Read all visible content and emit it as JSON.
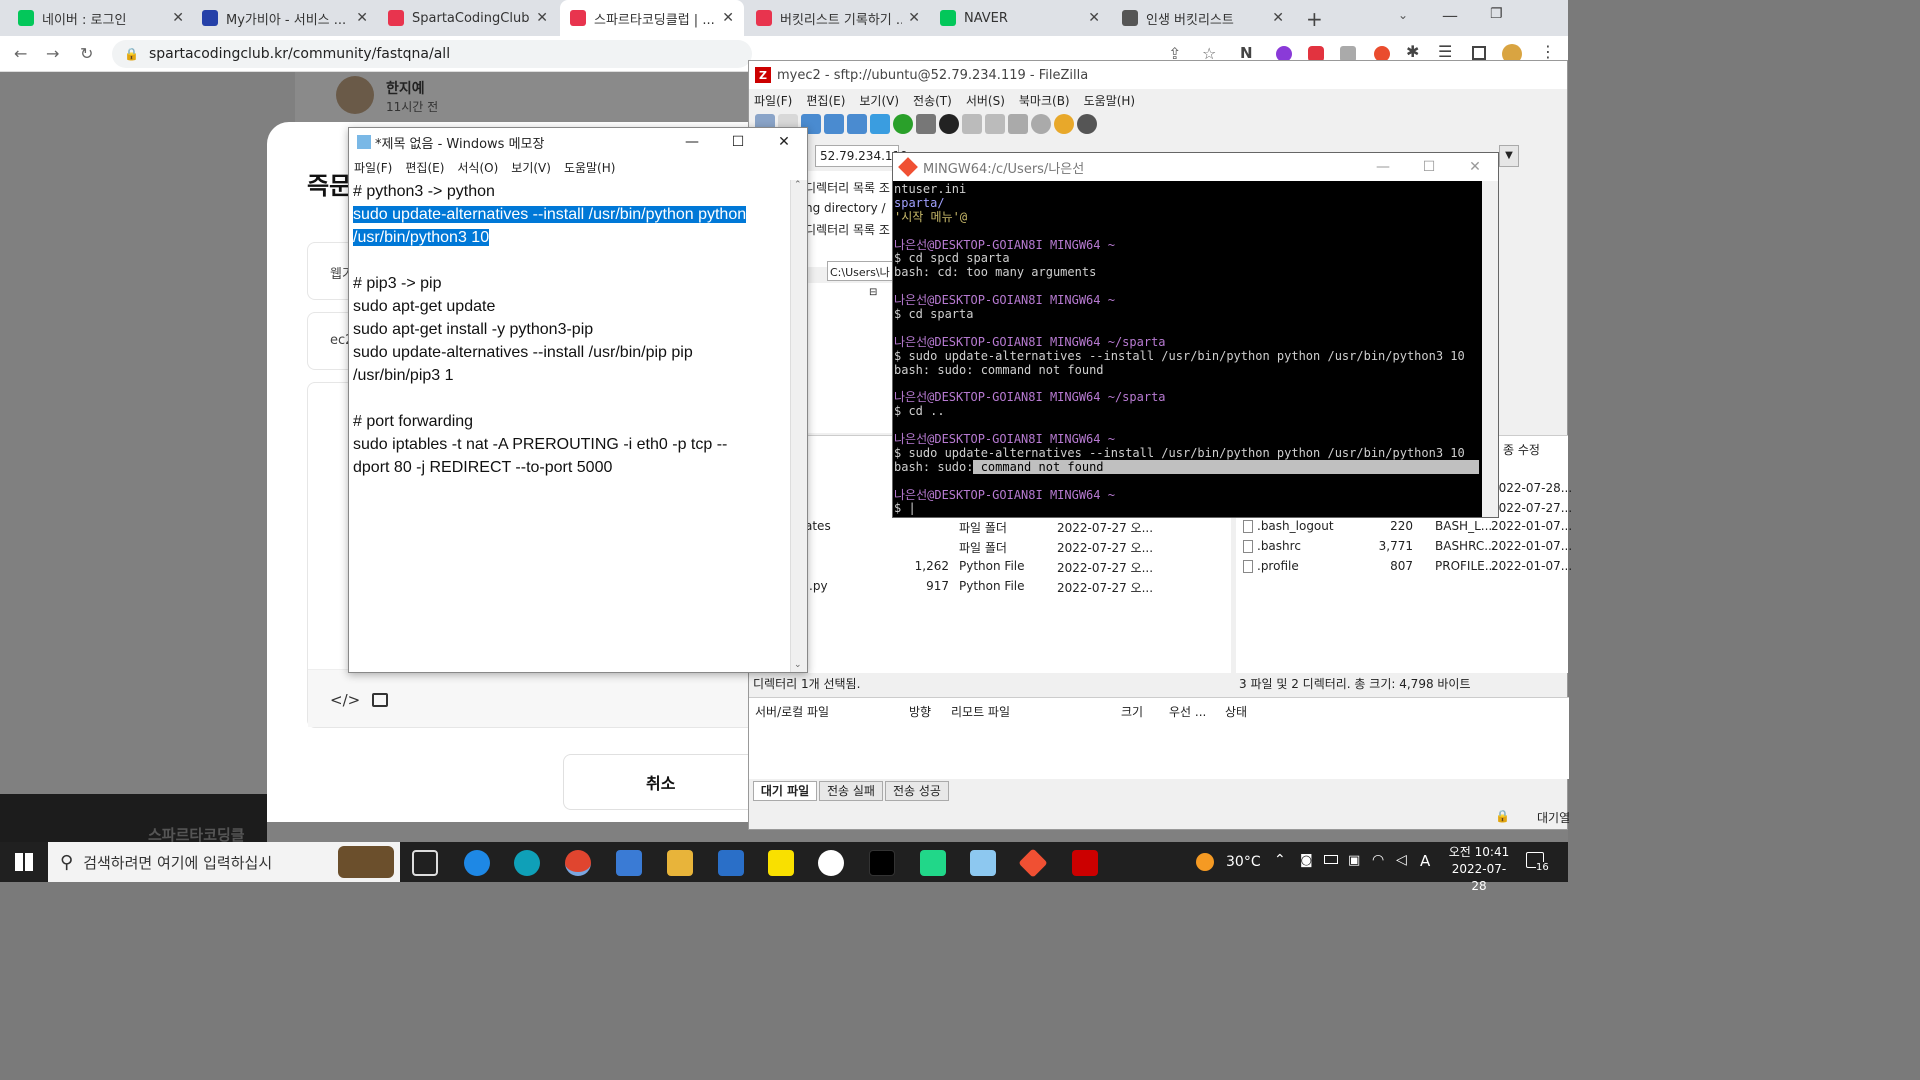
{
  "browser": {
    "tabs": [
      {
        "label": "네이버 : 로그인",
        "icon": "naver-icon",
        "color": "#03c75a"
      },
      {
        "label": "My가비아 - 서비스 ...",
        "icon": "gabia-icon",
        "color": "#2540a8"
      },
      {
        "label": "SpartaCodingClub",
        "icon": "sparta-icon",
        "color": "#e8344e"
      },
      {
        "label": "스파르타코딩클럽 | ...",
        "icon": "sparta-heart-icon",
        "color": "#e8344e"
      },
      {
        "label": "버킷리스트 기록하기 ...",
        "icon": "sparta-heart-icon",
        "color": "#e8344e"
      },
      {
        "label": "NAVER",
        "icon": "naver-icon",
        "color": "#03c75a"
      },
      {
        "label": "인생 버킷리스트",
        "icon": "globe-icon",
        "color": "#555555"
      }
    ],
    "url": "spartacodingclub.kr/community/fastqna/all"
  },
  "web": {
    "author_name": "한지예",
    "author_time": "11시간 전",
    "modal_title": "즉문",
    "field1": "웹기",
    "field2": "ec2",
    "cancel_label": "취소",
    "footer_text": "스파르타코딩클"
  },
  "notepad": {
    "title": "*제목 없음 - Windows 메모장",
    "menu": [
      "파일(F)",
      "편집(E)",
      "서식(O)",
      "보기(V)",
      "도움말(H)"
    ],
    "lines": [
      "# python3 -> python",
      "sudo update-alternatives --install /usr/bin/python python",
      "/usr/bin/python3 10",
      "",
      "# pip3 -> pip",
      "sudo apt-get update",
      "sudo apt-get install -y python3-pip",
      "sudo update-alternatives --install /usr/bin/pip pip",
      "/usr/bin/pip3 1",
      "",
      "# port forwarding",
      "sudo iptables -t nat -A PREROUTING -i eth0 -p tcp --",
      "dport 80 -j REDIRECT --to-port 5000"
    ]
  },
  "filezilla": {
    "title": "myec2 - sftp://ubuntu@52.79.234.119 - FileZilla",
    "menu": [
      "파일(F)",
      "편집(E)",
      "보기(V)",
      "전송(T)",
      "서버(S)",
      "북마크(B)",
      "도움말(H)"
    ],
    "host": "52.79.234.119",
    "local_log": [
      "디렉터리 목록 조",
      "ng directory /",
      "디렉터리 목록 조"
    ],
    "local_path": "C:\\Users\\나",
    "local_files": [
      {
        "name": "ates",
        "size": "",
        "type": "파일 폴더",
        "date": "2022-07-27 오..."
      },
      {
        "name": "",
        "size": "",
        "type": "파일 폴더",
        "date": "2022-07-27 오..."
      },
      {
        "name": "",
        "size": "1,262",
        "type": "Python File",
        "date": "2022-07-27 오..."
      },
      {
        "name": ":.py",
        "size": "917",
        "type": "Python File",
        "date": "2022-07-27 오..."
      }
    ],
    "remote_files": [
      {
        "name": ".bash_logout",
        "size": "220",
        "type": "BASH_L...",
        "date": "2022-01-07..."
      },
      {
        "name": ".bashrc",
        "size": "3,771",
        "type": "BASHRC...",
        "date": "2022-01-07..."
      },
      {
        "name": ".profile",
        "size": "807",
        "type": "PROFILE...",
        "date": "2022-01-07..."
      }
    ],
    "remote_header_modified": "종 수정",
    "remote_dates_top": [
      "2022-07-28...",
      "2022-07-27..."
    ],
    "local_status": "디렉터리 1개 선택됨.",
    "remote_status": "3 파일 및 2 디렉터리. 총 크기: 4,798 바이트",
    "queue_headers": [
      "서버/로컬 파일",
      "방향",
      "리모트 파일",
      "크기",
      "우선 ...",
      "상태"
    ],
    "queue_tabs": [
      "대기 파일",
      "전송 실패",
      "전송 성공"
    ],
    "bottom_right": "대기열"
  },
  "gitbash": {
    "title": "MINGW64:/c/Users/나은선",
    "lines": [
      {
        "t": "ntuser.ini",
        "c": "g"
      },
      {
        "t": "sparta/",
        "c": "b"
      },
      {
        "t": "'시작 메뉴'@",
        "c": "y"
      },
      {
        "t": "",
        "c": "g"
      },
      {
        "t": "나은선@DESKTOP-GOIAN8I MINGW64 ~",
        "c": "p"
      },
      {
        "t": "$ cd spcd sparta",
        "c": "g"
      },
      {
        "t": "bash: cd: too many arguments",
        "c": "g"
      },
      {
        "t": "",
        "c": "g"
      },
      {
        "t": "나은선@DESKTOP-GOIAN8I MINGW64 ~",
        "c": "p"
      },
      {
        "t": "$ cd sparta",
        "c": "g"
      },
      {
        "t": "",
        "c": "g"
      },
      {
        "t": "나은선@DESKTOP-GOIAN8I MINGW64 ~/sparta",
        "c": "p"
      },
      {
        "t": "$ sudo update-alternatives --install /usr/bin/python python /usr/bin/python3 10",
        "c": "g"
      },
      {
        "t": "bash: sudo: command not found",
        "c": "g"
      },
      {
        "t": "",
        "c": "g"
      },
      {
        "t": "나은선@DESKTOP-GOIAN8I MINGW64 ~/sparta",
        "c": "p"
      },
      {
        "t": "$ cd ..",
        "c": "g"
      },
      {
        "t": "",
        "c": "g"
      },
      {
        "t": "나은선@DESKTOP-GOIAN8I MINGW64 ~",
        "c": "p"
      },
      {
        "t": "$ sudo update-alternatives --install /usr/bin/python python /usr/bin/python3 10",
        "c": "g"
      },
      {
        "t": "bash: sudo: command not found",
        "c": "g"
      },
      {
        "t": "",
        "c": "g"
      },
      {
        "t": "나은선@DESKTOP-GOIAN8I MINGW64 ~",
        "c": "p"
      },
      {
        "t": "$ |",
        "c": "g"
      }
    ]
  },
  "taskbar": {
    "search_placeholder": "검색하려면 여기에 입력하십시",
    "temperature": "30°C",
    "ime": "A",
    "time_prefix": "오전",
    "time": "10:41",
    "date": "2022-07-28",
    "notification_count": "16"
  }
}
